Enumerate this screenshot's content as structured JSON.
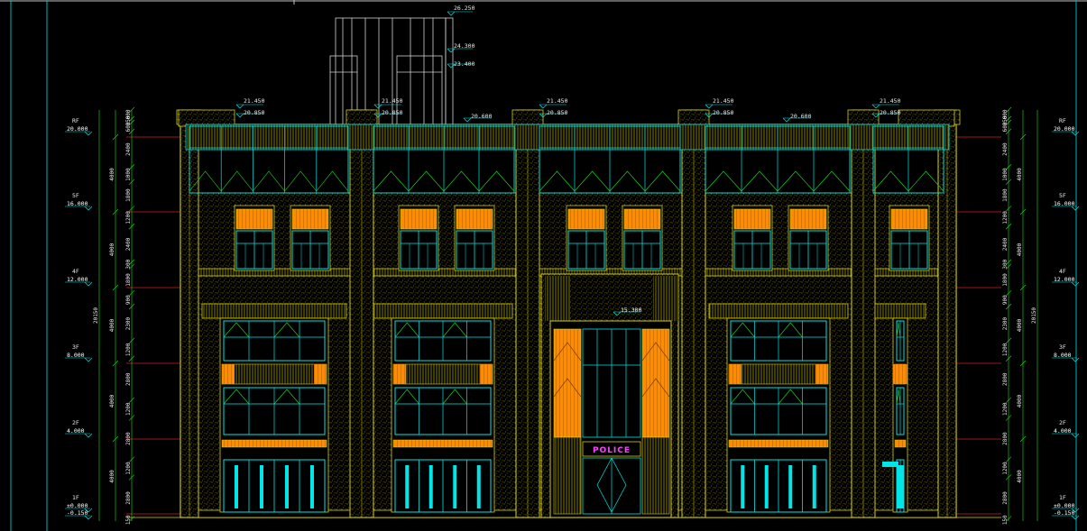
{
  "colors": {
    "background": "#000000",
    "wall_outline": "#d8d000",
    "glazing": "#00e5e5",
    "accent_panel": "#ff8c00",
    "floor_line": "#d02020",
    "axis_line": "#00b0b0",
    "sign_text": "#ff44ff"
  },
  "elevations_top": {
    "roof_peak": "26.250",
    "roof_mid": "24.300",
    "roof_low": "23.400",
    "parapet_left_1": "21.450",
    "parapet_left_2": "20.850",
    "parapet_2_1": "21.450",
    "parapet_2_2": "20.850",
    "parapet_3_1": "21.450",
    "parapet_3_2": "20.850",
    "parapet_4_1": "21.450",
    "parapet_4_2": "20.850",
    "parapet_right_1": "21.450",
    "parapet_right_2": "20.850",
    "roof_mid_left": "20.600",
    "roof_mid_right": "20.600",
    "canopy": "15.300"
  },
  "levels_left": [
    {
      "floor": "RF",
      "value": "20.000"
    },
    {
      "floor": "5F",
      "value": "16.000"
    },
    {
      "floor": "4F",
      "value": "12.000"
    },
    {
      "floor": "3F",
      "value": "8.000"
    },
    {
      "floor": "2F",
      "value": "4.000"
    },
    {
      "floor": "1F",
      "value": "±0.000"
    },
    {
      "floor": "",
      "value": "-0.150"
    }
  ],
  "levels_right": [
    {
      "floor": "RF",
      "value": "20.000"
    },
    {
      "floor": "5F",
      "value": "16.000"
    },
    {
      "floor": "4F",
      "value": "12.000"
    },
    {
      "floor": "3F",
      "value": "8.000"
    },
    {
      "floor": "2F",
      "value": "4.000"
    },
    {
      "floor": "1F",
      "value": "±0.000"
    },
    {
      "floor": "",
      "value": "-0.150"
    }
  ],
  "dims_left_outer": [
    "20150"
  ],
  "dims_left_mid": [
    "4000",
    "4000",
    "4000",
    "4000",
    "4000"
  ],
  "dims_left_inner": [
    "600",
    "250",
    "600",
    "2400",
    "1000",
    "1800",
    "1200",
    "2400",
    "300",
    "1800",
    "900",
    "2300",
    "1200",
    "2800",
    "1200",
    "2800",
    "1200",
    "2800",
    "150"
  ],
  "dims_right_outer": [
    "20150"
  ],
  "dims_right_mid": [
    "4000",
    "4000",
    "4000",
    "4000",
    "4000"
  ],
  "dims_right_inner": [
    "600",
    "250",
    "600",
    "2400",
    "1000",
    "1800",
    "1200",
    "2400",
    "300",
    "1800",
    "900",
    "2300",
    "1200",
    "2800",
    "1200",
    "2800",
    "1200",
    "2800",
    "150"
  ],
  "entrance_sign": "POLICE"
}
